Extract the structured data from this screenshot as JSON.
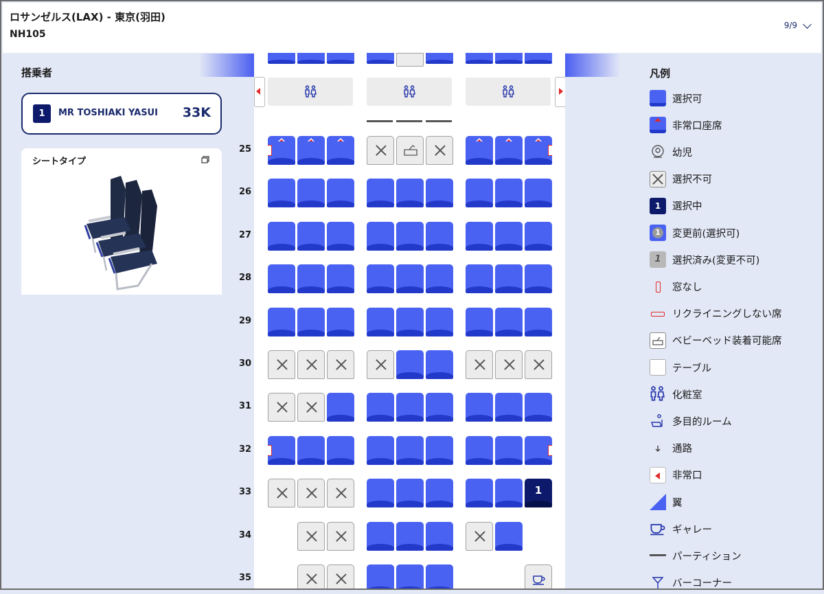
{
  "header": {
    "route": "ロサンゼルス(LAX) - 東京(羽田)",
    "flight": "NH105",
    "page_indicator": "9/9"
  },
  "passengers": {
    "title": "搭乗者",
    "items": [
      {
        "number": "1",
        "name": "MR TOSHIAKI YASUI",
        "seat": "33K"
      }
    ]
  },
  "seat_type": {
    "title": "シートタイプ"
  },
  "seat_map": {
    "rows": [
      "25",
      "26",
      "27",
      "28",
      "29",
      "30",
      "31",
      "32",
      "33",
      "34",
      "35"
    ],
    "selected_seat_label": "1"
  },
  "legend": {
    "title": "凡例",
    "items": [
      {
        "label": "選択可",
        "icon": "available-seat-icon"
      },
      {
        "label": "非常口座席",
        "icon": "exit-row-seat-icon"
      },
      {
        "label": "幼児",
        "icon": "infant-icon"
      },
      {
        "label": "選択不可",
        "icon": "unavailable-seat-icon"
      },
      {
        "label": "選択中",
        "icon": "selected-seat-icon",
        "value": "1"
      },
      {
        "label": "変更前(選択可)",
        "icon": "previous-seat-icon",
        "value": "1"
      },
      {
        "label": "選択済み(変更不可)",
        "icon": "locked-seat-icon",
        "value": "1"
      },
      {
        "label": "窓なし",
        "icon": "no-window-icon"
      },
      {
        "label": "リクライニングしない席",
        "icon": "no-recline-icon"
      },
      {
        "label": "ベビーベッド装着可能席",
        "icon": "bassinet-icon"
      },
      {
        "label": "テーブル",
        "icon": "table-icon"
      },
      {
        "label": "化粧室",
        "icon": "lavatory-icon"
      },
      {
        "label": "多目的ルーム",
        "icon": "multipurpose-room-icon"
      },
      {
        "label": "通路",
        "icon": "aisle-icon"
      },
      {
        "label": "非常口",
        "icon": "emergency-exit-icon"
      },
      {
        "label": "翼",
        "icon": "wing-icon"
      },
      {
        "label": "ギャレー",
        "icon": "galley-icon"
      },
      {
        "label": "パーティション",
        "icon": "partition-icon"
      },
      {
        "label": "バーコーナー",
        "icon": "bar-corner-icon"
      }
    ]
  },
  "colors": {
    "available": "#4a62f1",
    "selected": "#0d1a6b",
    "unavailable": "#ececec",
    "exit": "#e02a2a"
  }
}
